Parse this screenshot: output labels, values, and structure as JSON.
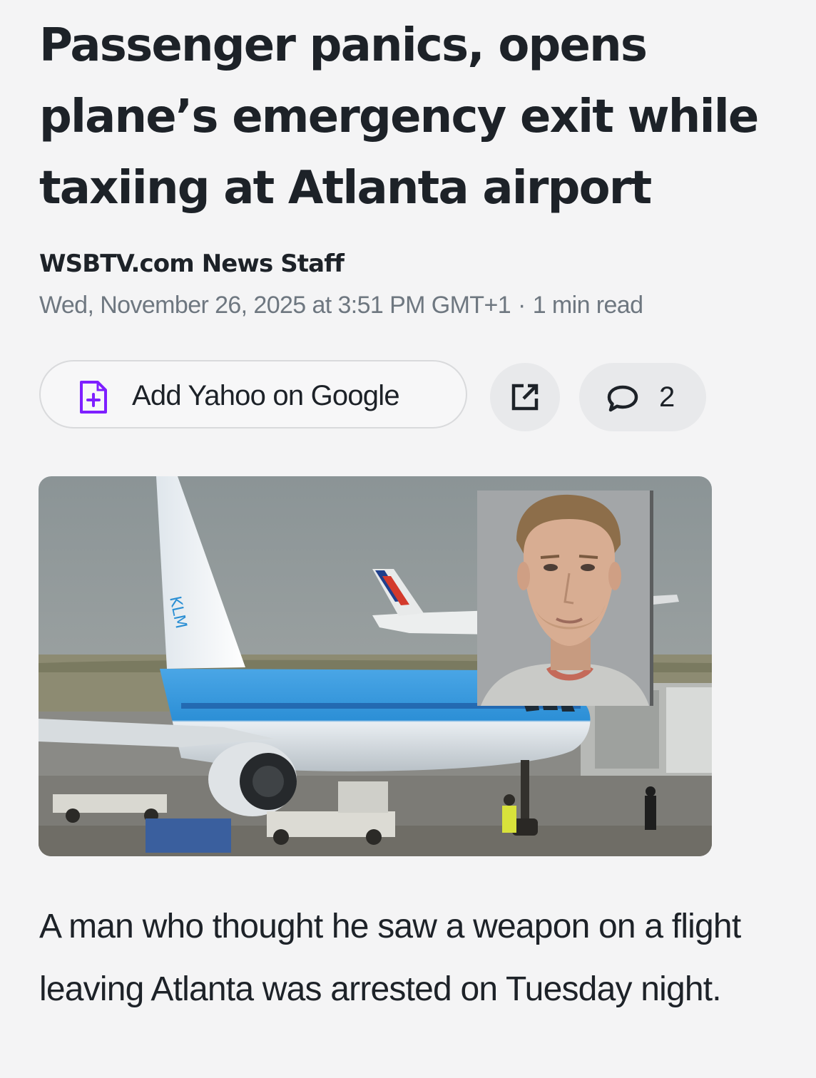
{
  "article": {
    "headline": "Passenger panics, opens plane’s emergency exit while taxiing at Atlanta airport",
    "byline": "WSBTV.com News Staff",
    "date": "Wed, November 26, 2025 at 3:51 PM GMT+1",
    "separator": "·",
    "read_time": "1 min read",
    "body": "A man who thought he saw a weapon on a flight leaving Atlanta was arrested on Tuesday night."
  },
  "actions": {
    "add_source_label": "Add Yahoo on Google",
    "add_source_icon": "doc-plus-icon",
    "share_icon": "share-icon",
    "comment_icon": "comment-icon",
    "comment_count": "2"
  },
  "hero_image": {
    "logo_text": "KLM",
    "inset": "mugshot"
  },
  "colors": {
    "background": "#f4f4f5",
    "text": "#1d2228",
    "muted": "#6e7780",
    "accent": "#7e1fff",
    "klm_blue": "#3ea0e0"
  }
}
